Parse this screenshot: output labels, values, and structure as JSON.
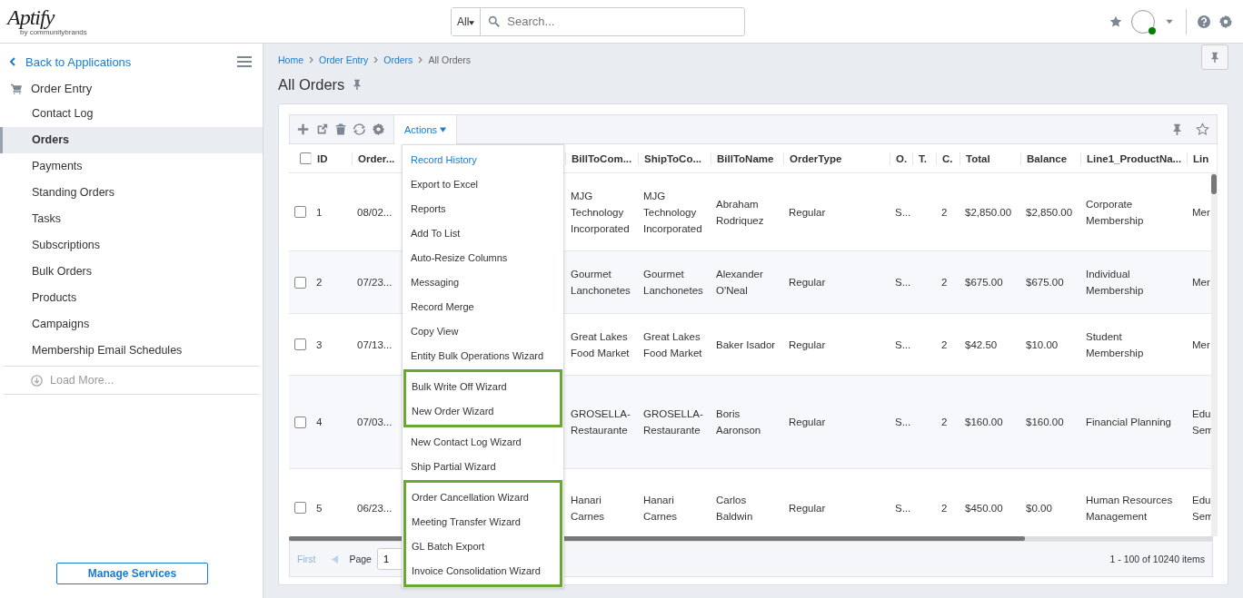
{
  "header": {
    "logo": "Aptify",
    "logo_tagline": "by communitybrands",
    "search": {
      "scope": "All",
      "placeholder": "Search..."
    }
  },
  "sidebar": {
    "back": "Back to Applications",
    "section": "Order Entry",
    "items": [
      {
        "label": "Contact Log",
        "selected": false
      },
      {
        "label": "Orders",
        "selected": true
      },
      {
        "label": "Payments",
        "selected": false
      },
      {
        "label": "Standing Orders",
        "selected": false
      },
      {
        "label": "Tasks",
        "selected": false
      },
      {
        "label": "Subscriptions",
        "selected": false
      },
      {
        "label": "Bulk Orders",
        "selected": false
      },
      {
        "label": "Products",
        "selected": false
      },
      {
        "label": "Campaigns",
        "selected": false
      },
      {
        "label": "Membership Email Schedules",
        "selected": false
      }
    ],
    "load_more": "Load More...",
    "manage": "Manage Services"
  },
  "breadcrumb": [
    "Home",
    "Order Entry",
    "Orders",
    "All Orders"
  ],
  "title": "All Orders",
  "toolbar": {
    "actions": "Actions"
  },
  "menu": {
    "groups": [
      {
        "highlighted": false,
        "items": [
          {
            "label": "Record History",
            "selected": true
          },
          {
            "label": "Export to Excel",
            "selected": false
          },
          {
            "label": "Reports",
            "selected": false
          },
          {
            "label": "Add To List",
            "selected": false
          },
          {
            "label": "Auto-Resize Columns",
            "selected": false
          },
          {
            "label": "Messaging",
            "selected": false
          },
          {
            "label": "Record Merge",
            "selected": false
          },
          {
            "label": "Copy View",
            "selected": false
          },
          {
            "label": "Entity Bulk Operations Wizard",
            "selected": false
          }
        ]
      },
      {
        "highlighted": true,
        "items": [
          {
            "label": "Bulk Write Off Wizard",
            "selected": false
          },
          {
            "label": "New Order Wizard",
            "selected": false
          }
        ]
      },
      {
        "highlighted": false,
        "items": [
          {
            "label": "New Contact Log Wizard",
            "selected": false
          },
          {
            "label": "Ship Partial Wizard",
            "selected": false
          }
        ]
      },
      {
        "highlighted": true,
        "items": [
          {
            "label": "Order Cancellation Wizard",
            "selected": false
          },
          {
            "label": "Meeting Transfer Wizard",
            "selected": false
          },
          {
            "label": "GL Batch Export",
            "selected": false
          },
          {
            "label": "Invoice Consolidation Wizard",
            "selected": false
          }
        ]
      }
    ]
  },
  "table": {
    "all_checked": false,
    "columns": [
      "ID",
      "Order...",
      "BillToCom...",
      "ShipToCo...",
      "BillToName",
      "OrderType",
      "O.",
      "T.",
      "C.",
      "Total",
      "Balance",
      "Line1_ProductNa...",
      "Lin"
    ],
    "rows": [
      {
        "checked": false,
        "cells": [
          "1",
          "08/02...",
          "MJG Technology Incorporated",
          "MJG Technology Incorporated",
          "Abraham Rodriquez",
          "Regular",
          "S...",
          "",
          "2",
          "$2,850.00",
          "$2,850.00",
          "Corporate Membership",
          "Mer"
        ]
      },
      {
        "checked": false,
        "cells": [
          "2",
          "07/23...",
          "Gourmet Lanchonetes",
          "Gourmet Lanchonetes",
          "Alexander O'Neal",
          "Regular",
          "S...",
          "",
          "2",
          "$675.00",
          "$675.00",
          "Individual Membership",
          "Mer"
        ]
      },
      {
        "checked": false,
        "cells": [
          "3",
          "07/13...",
          "Great Lakes Food Market",
          "Great Lakes Food Market",
          "Baker Isador",
          "Regular",
          "S...",
          "",
          "2",
          "$42.50",
          "$10.00",
          "Student Membership",
          "Mer"
        ]
      },
      {
        "checked": false,
        "cells": [
          "4",
          "07/03...",
          "GROSELLA-Restaurante",
          "GROSELLA-Restaurante",
          "Boris Aaronson",
          "Regular",
          "S...",
          "",
          "2",
          "$160.00",
          "$160.00",
          "Financial Planning",
          "Edu Sem"
        ]
      },
      {
        "checked": false,
        "cells": [
          "5",
          "06/23...",
          "Hanari Carnes",
          "Hanari Carnes",
          "Carlos Baldwin",
          "Regular",
          "S...",
          "",
          "2",
          "$450.00",
          "$0.00",
          "Human Resources Management",
          "Edu Sem"
        ]
      }
    ]
  },
  "pager": {
    "first": "First",
    "page_label": "Page",
    "page": "1",
    "summary": "1 - 100 of 10240 items"
  }
}
